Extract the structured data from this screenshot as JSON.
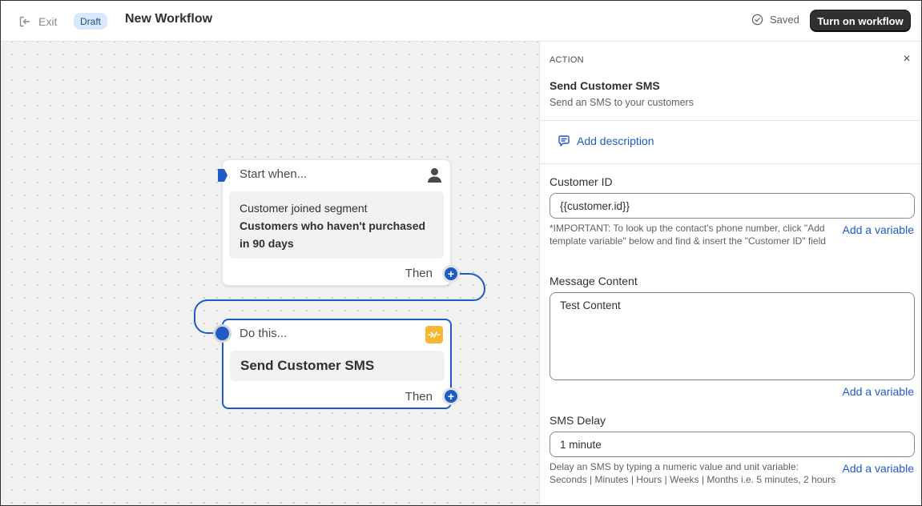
{
  "header": {
    "exit_label": "Exit",
    "status_badge": "Draft",
    "title": "New Workflow",
    "saved_label": "Saved",
    "turn_on_label": "Turn on workflow"
  },
  "canvas": {
    "trigger": {
      "heading": "Start when...",
      "event": "Customer joined segment",
      "segment": "Customers who haven't purchased in 90 days",
      "then": "Then",
      "icon": "person-icon"
    },
    "action": {
      "heading": "Do this...",
      "name": "Send Customer SMS",
      "then": "Then",
      "icon": "app-badge-icon"
    }
  },
  "panel": {
    "kicker": "ACTION",
    "close_glyph": "×",
    "title": "Send Customer SMS",
    "subtitle": "Send an SMS to your customers",
    "add_description": "Add description",
    "fields": [
      {
        "label": "Customer ID",
        "value": "{{customer.id}}",
        "help": "*IMPORTANT: To look up the contact’s phone number, click \"Add template variable\" below and find & insert the \"Customer ID\" field",
        "variable_link": "Add a variable"
      },
      {
        "label": "Message Content",
        "value": "Test Content",
        "variable_link": "Add a variable"
      },
      {
        "label": "SMS Delay",
        "value": "1 minute",
        "help": "Delay an SMS by typing a numeric value and unit variable: Seconds | Minutes | Hours | Weeks | Months i.e. 5 minutes, 2 hours",
        "variable_link": "Add a variable"
      }
    ]
  },
  "colors": {
    "accent": "#1f5bc6",
    "primary_button": "#303030",
    "badge_bg": "#d8e9fb",
    "app_badge": "#f7b733",
    "canvas_bg": "#f1f1f1"
  }
}
